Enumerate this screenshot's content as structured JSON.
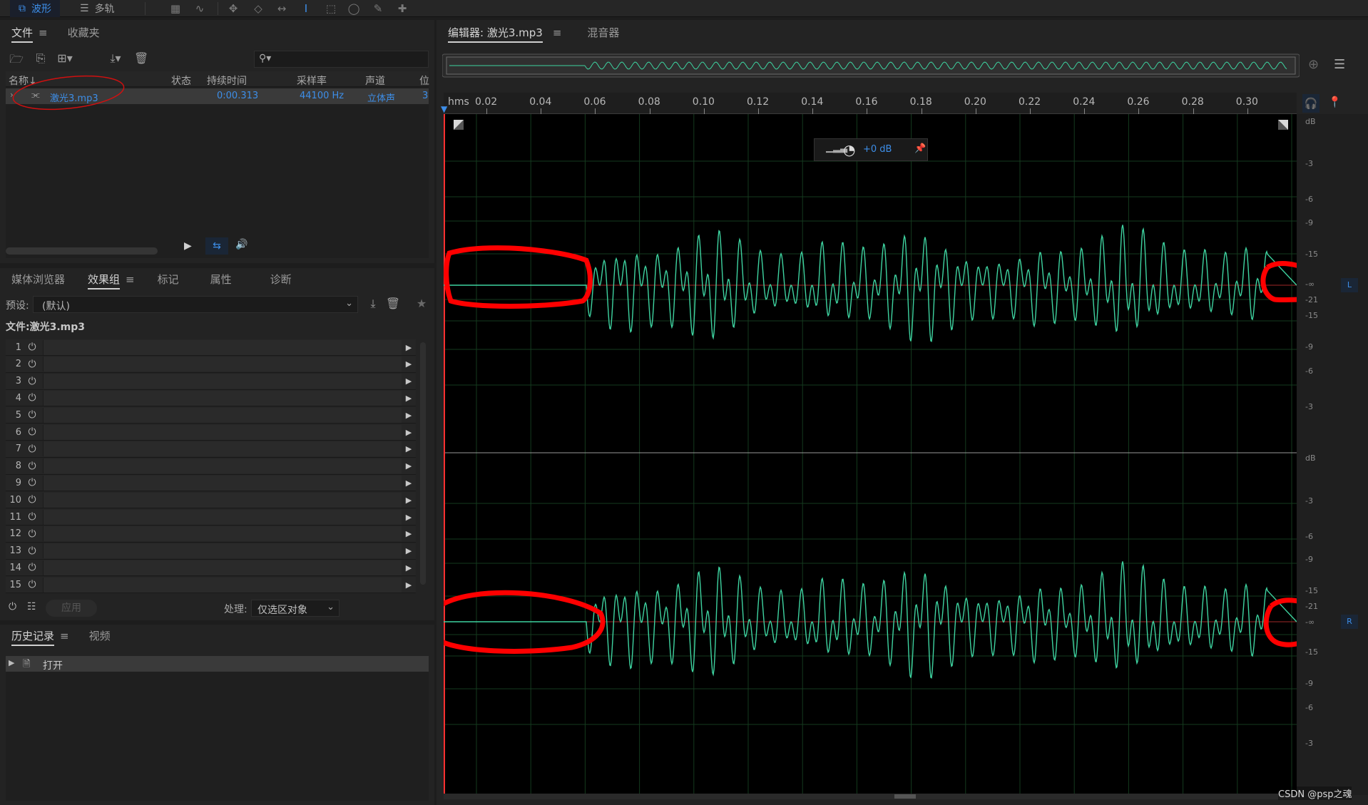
{
  "toolbar": {
    "modes": [
      {
        "label": "波形",
        "icon": "waveform-view-icon",
        "active": true
      },
      {
        "label": "多轨",
        "icon": "multitrack-view-icon",
        "active": false
      }
    ],
    "tools": [
      "spectral-frequency-icon",
      "spectral-pitch-icon",
      "move-tool-icon",
      "razor-tool-icon",
      "slip-tool-icon",
      "time-selection-tool-icon",
      "marquee-tool-icon",
      "lasso-tool-icon",
      "brush-tool-icon",
      "spot-healing-icon"
    ]
  },
  "files_panel": {
    "tabs": [
      {
        "label": "文件",
        "active": true
      },
      {
        "label": "收藏夹",
        "active": false
      }
    ],
    "search_placeholder": "",
    "columns": [
      "名称",
      "状态",
      "持续时间",
      "采样率",
      "声道",
      "位"
    ],
    "sort_indicator": "↓",
    "rows": [
      {
        "name": "激光3.mp3",
        "status": "",
        "duration": "0:00.313",
        "sample_rate": "44100 Hz",
        "channels": "立体声",
        "bits": "3"
      }
    ]
  },
  "effects_panel": {
    "tabs": [
      {
        "label": "媒体浏览器",
        "active": false
      },
      {
        "label": "效果组",
        "active": true
      },
      {
        "label": "标记",
        "active": false
      },
      {
        "label": "属性",
        "active": false
      },
      {
        "label": "诊断",
        "active": false
      }
    ],
    "preset_label": "预设:",
    "preset_value": "(默认)",
    "file_label": "文件:激光3.mp3",
    "slots": [
      "1",
      "2",
      "3",
      "4",
      "5",
      "6",
      "7",
      "8",
      "9",
      "10",
      "11",
      "12",
      "13",
      "14",
      "15"
    ],
    "apply_label": "应用",
    "process_label": "处理:",
    "process_value": "仅选区对象"
  },
  "history_panel": {
    "tabs": [
      {
        "label": "历史记录",
        "active": true
      },
      {
        "label": "视频",
        "active": false
      }
    ],
    "items": [
      {
        "label": "打开"
      }
    ]
  },
  "editor": {
    "tabs": [
      {
        "label": "编辑器: 激光3.mp3",
        "active": true
      },
      {
        "label": "混音器",
        "active": false
      }
    ],
    "ruler_unit": "hms",
    "ruler_ticks": [
      "0.02",
      "0.04",
      "0.06",
      "0.08",
      "0.10",
      "0.12",
      "0.14",
      "0.16",
      "0.18",
      "0.20",
      "0.22",
      "0.24",
      "0.26",
      "0.28",
      "0.30"
    ],
    "hud_gain": "+0 dB",
    "db_scale_top": [
      "dB",
      "-3",
      "-6",
      "-9",
      "-15",
      "-∞",
      "-21",
      "-15",
      "-9",
      "-6",
      "-3"
    ],
    "db_scale_bottom": [
      "dB",
      "-3",
      "-6",
      "-9",
      "-15",
      "-21",
      "-∞",
      "-15",
      "-9",
      "-6",
      "-3"
    ],
    "channel_left": "L",
    "channel_right": "R",
    "watermark": "CSDN @psp之魂"
  },
  "colors": {
    "accent": "#3d8ee8",
    "waveform": "#3ed3a0",
    "annotation": "#ff0000",
    "playhead": "#ff3030"
  }
}
